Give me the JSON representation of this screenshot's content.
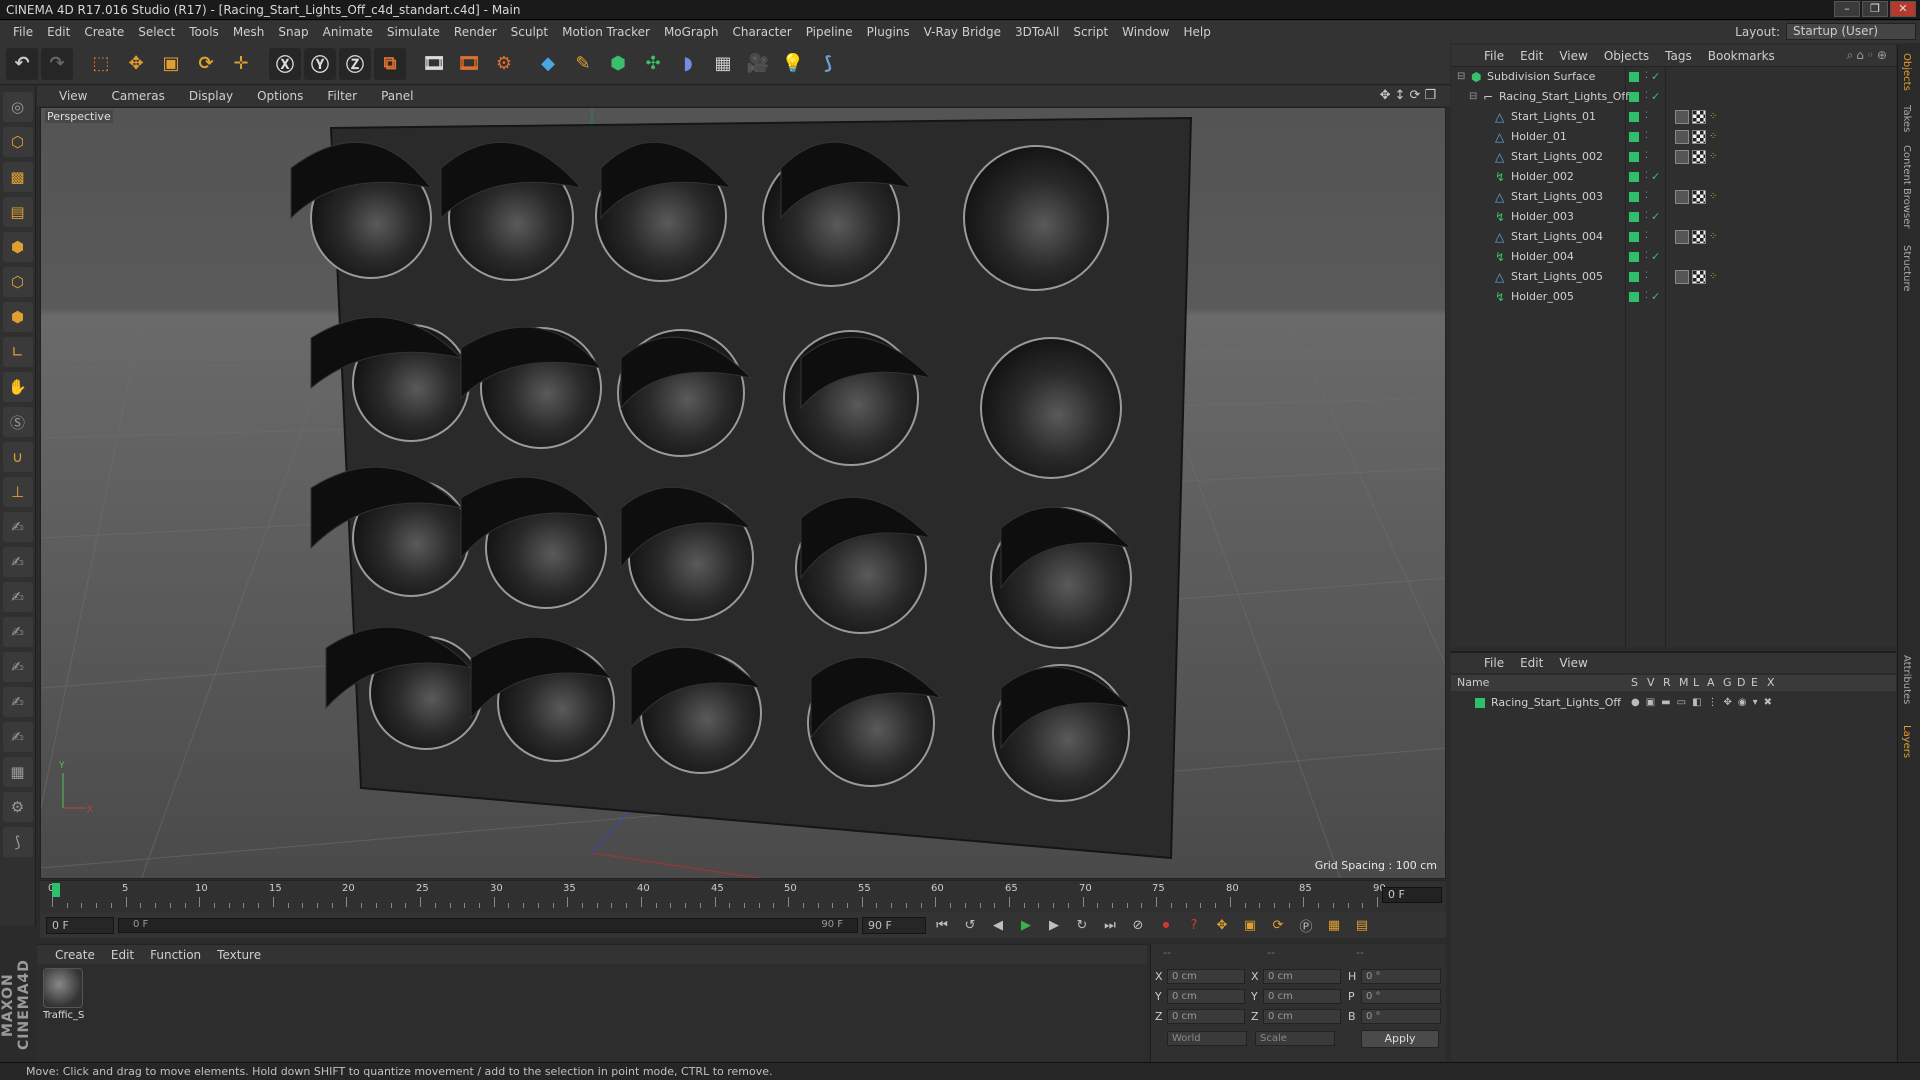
{
  "window": {
    "title": "CINEMA 4D R17.016 Studio (R17) - [Racing_Start_Lights_Off_c4d_standart.c4d] - Main"
  },
  "menubar": {
    "items": [
      "File",
      "Edit",
      "Create",
      "Select",
      "Tools",
      "Mesh",
      "Snap",
      "Animate",
      "Simulate",
      "Render",
      "Sculpt",
      "Motion Tracker",
      "MoGraph",
      "Character",
      "Pipeline",
      "Plugins",
      "V-Ray Bridge",
      "3DToAll",
      "Script",
      "Window",
      "Help"
    ],
    "layout_label": "Layout:",
    "layout_value": "Startup (User)"
  },
  "viewport": {
    "menu": [
      "View",
      "Cameras",
      "Display",
      "Options",
      "Filter",
      "Panel"
    ],
    "label": "Perspective",
    "grid_spacing": "Grid Spacing : 100 cm"
  },
  "timeline": {
    "ticks": [
      "0",
      "5",
      "10",
      "15",
      "20",
      "25",
      "30",
      "35",
      "40",
      "45",
      "50",
      "55",
      "60",
      "65",
      "70",
      "75",
      "80",
      "85",
      "90"
    ],
    "current_frame": "0 F",
    "start_field": "0 F",
    "range_start": "0 F",
    "range_end": "90 F",
    "end_field": "90 F"
  },
  "materials": {
    "menu": [
      "Create",
      "Edit",
      "Function",
      "Texture"
    ],
    "items": [
      {
        "name": "Traffic_S"
      }
    ]
  },
  "coordinates": {
    "headers": [
      "--",
      "--",
      "--"
    ],
    "rows": [
      {
        "a": "X",
        "av": "0 cm",
        "b": "X",
        "bv": "0 cm",
        "c": "H",
        "cv": "0 °"
      },
      {
        "a": "Y",
        "av": "0 cm",
        "b": "Y",
        "bv": "0 cm",
        "c": "P",
        "cv": "0 °"
      },
      {
        "a": "Z",
        "av": "0 cm",
        "b": "Z",
        "bv": "0 cm",
        "c": "B",
        "cv": "0 °"
      }
    ],
    "space": "World",
    "mode": "Scale",
    "apply": "Apply"
  },
  "objects": {
    "menu": [
      "File",
      "Edit",
      "View",
      "Objects",
      "Tags",
      "Bookmarks"
    ],
    "items": [
      {
        "name": "Subdivision Surface",
        "depth": 0,
        "type": "subdiv",
        "tags": false
      },
      {
        "name": "Racing_Start_Lights_Off",
        "depth": 1,
        "type": "null",
        "tags": false
      },
      {
        "name": "Start_Lights_01",
        "depth": 2,
        "type": "poly",
        "tags": true
      },
      {
        "name": "Holder_01",
        "depth": 2,
        "type": "poly",
        "tags": true
      },
      {
        "name": "Start_Lights_002",
        "depth": 2,
        "type": "poly",
        "tags": true
      },
      {
        "name": "Holder_002",
        "depth": 2,
        "type": "holder",
        "tags": false
      },
      {
        "name": "Start_Lights_003",
        "depth": 2,
        "type": "poly",
        "tags": true
      },
      {
        "name": "Holder_003",
        "depth": 2,
        "type": "holder",
        "tags": false
      },
      {
        "name": "Start_Lights_004",
        "depth": 2,
        "type": "poly",
        "tags": true
      },
      {
        "name": "Holder_004",
        "depth": 2,
        "type": "holder",
        "tags": false
      },
      {
        "name": "Start_Lights_005",
        "depth": 2,
        "type": "poly",
        "tags": true
      },
      {
        "name": "Holder_005",
        "depth": 2,
        "type": "holder",
        "tags": false
      }
    ]
  },
  "layers": {
    "menu": [
      "File",
      "Edit",
      "View"
    ],
    "columns": [
      "Name",
      "S",
      "V",
      "R",
      "M",
      "L",
      "A",
      "G",
      "D",
      "E",
      "X"
    ],
    "items": [
      {
        "name": "Racing_Start_Lights_Off"
      }
    ]
  },
  "side_tabs": [
    "Objects",
    "Takes",
    "Content Browser",
    "Structure",
    "Attributes",
    "Layers"
  ],
  "status": {
    "text": "Move: Click and drag to move elements. Hold down SHIFT to quantize movement / add to the selection in point mode, CTRL to remove."
  },
  "colors": {
    "accent": "#e0a030",
    "layer_green": "#2dbf6a",
    "play_green": "#3ab34a",
    "record_red": "#d13a2e"
  }
}
